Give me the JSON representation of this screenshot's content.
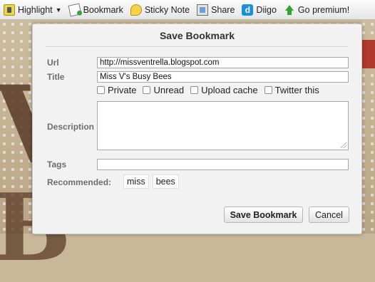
{
  "toolbar": {
    "items": [
      {
        "label": "Highlight",
        "icon": "highlighter-icon"
      },
      {
        "label": "Bookmark",
        "icon": "bookmark-icon"
      },
      {
        "label": "Sticky Note",
        "icon": "sticky-note-icon"
      },
      {
        "label": "Share",
        "icon": "share-icon"
      },
      {
        "label": "Diigo",
        "icon": "diigo-logo-icon"
      },
      {
        "label": "Go premium!",
        "icon": "premium-arrow-icon"
      }
    ],
    "diigo_glyph": "d"
  },
  "dialog": {
    "title": "Save Bookmark",
    "url_label": "Url",
    "url_value": "http://missventrella.blogspot.com",
    "title_label": "Title",
    "title_value": "Miss V's Busy Bees",
    "options": [
      "Private",
      "Unread",
      "Upload cache",
      "Twitter this"
    ],
    "description_label": "Description",
    "description_value": "",
    "tags_label": "Tags",
    "tags_value": "",
    "recommended_label": "Recommended:",
    "recommended_tags": [
      "miss",
      "bees"
    ],
    "save_label": "Save Bookmark",
    "cancel_label": "Cancel"
  }
}
